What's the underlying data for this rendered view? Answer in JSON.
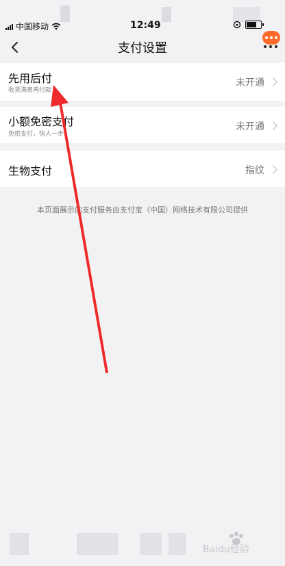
{
  "status": {
    "carrier": "中国移动",
    "time": "12:49"
  },
  "nav": {
    "title": "支付设置"
  },
  "rows": [
    {
      "title": "先用后付",
      "subtitle": "收货满意再付款",
      "value": "未开通"
    },
    {
      "title": "小额免密支付",
      "subtitle": "免密支付，快人一步",
      "value": "未开通"
    },
    {
      "title": "生物支付",
      "value": "指纹"
    }
  ],
  "footer": "本页面展示的支付服务由支付宝（中国）网络技术有限公司提供",
  "watermark": "Baidu经验",
  "colors": {
    "annotation_arrow": "#ee2a2a",
    "accent": "#ff6a2a"
  }
}
